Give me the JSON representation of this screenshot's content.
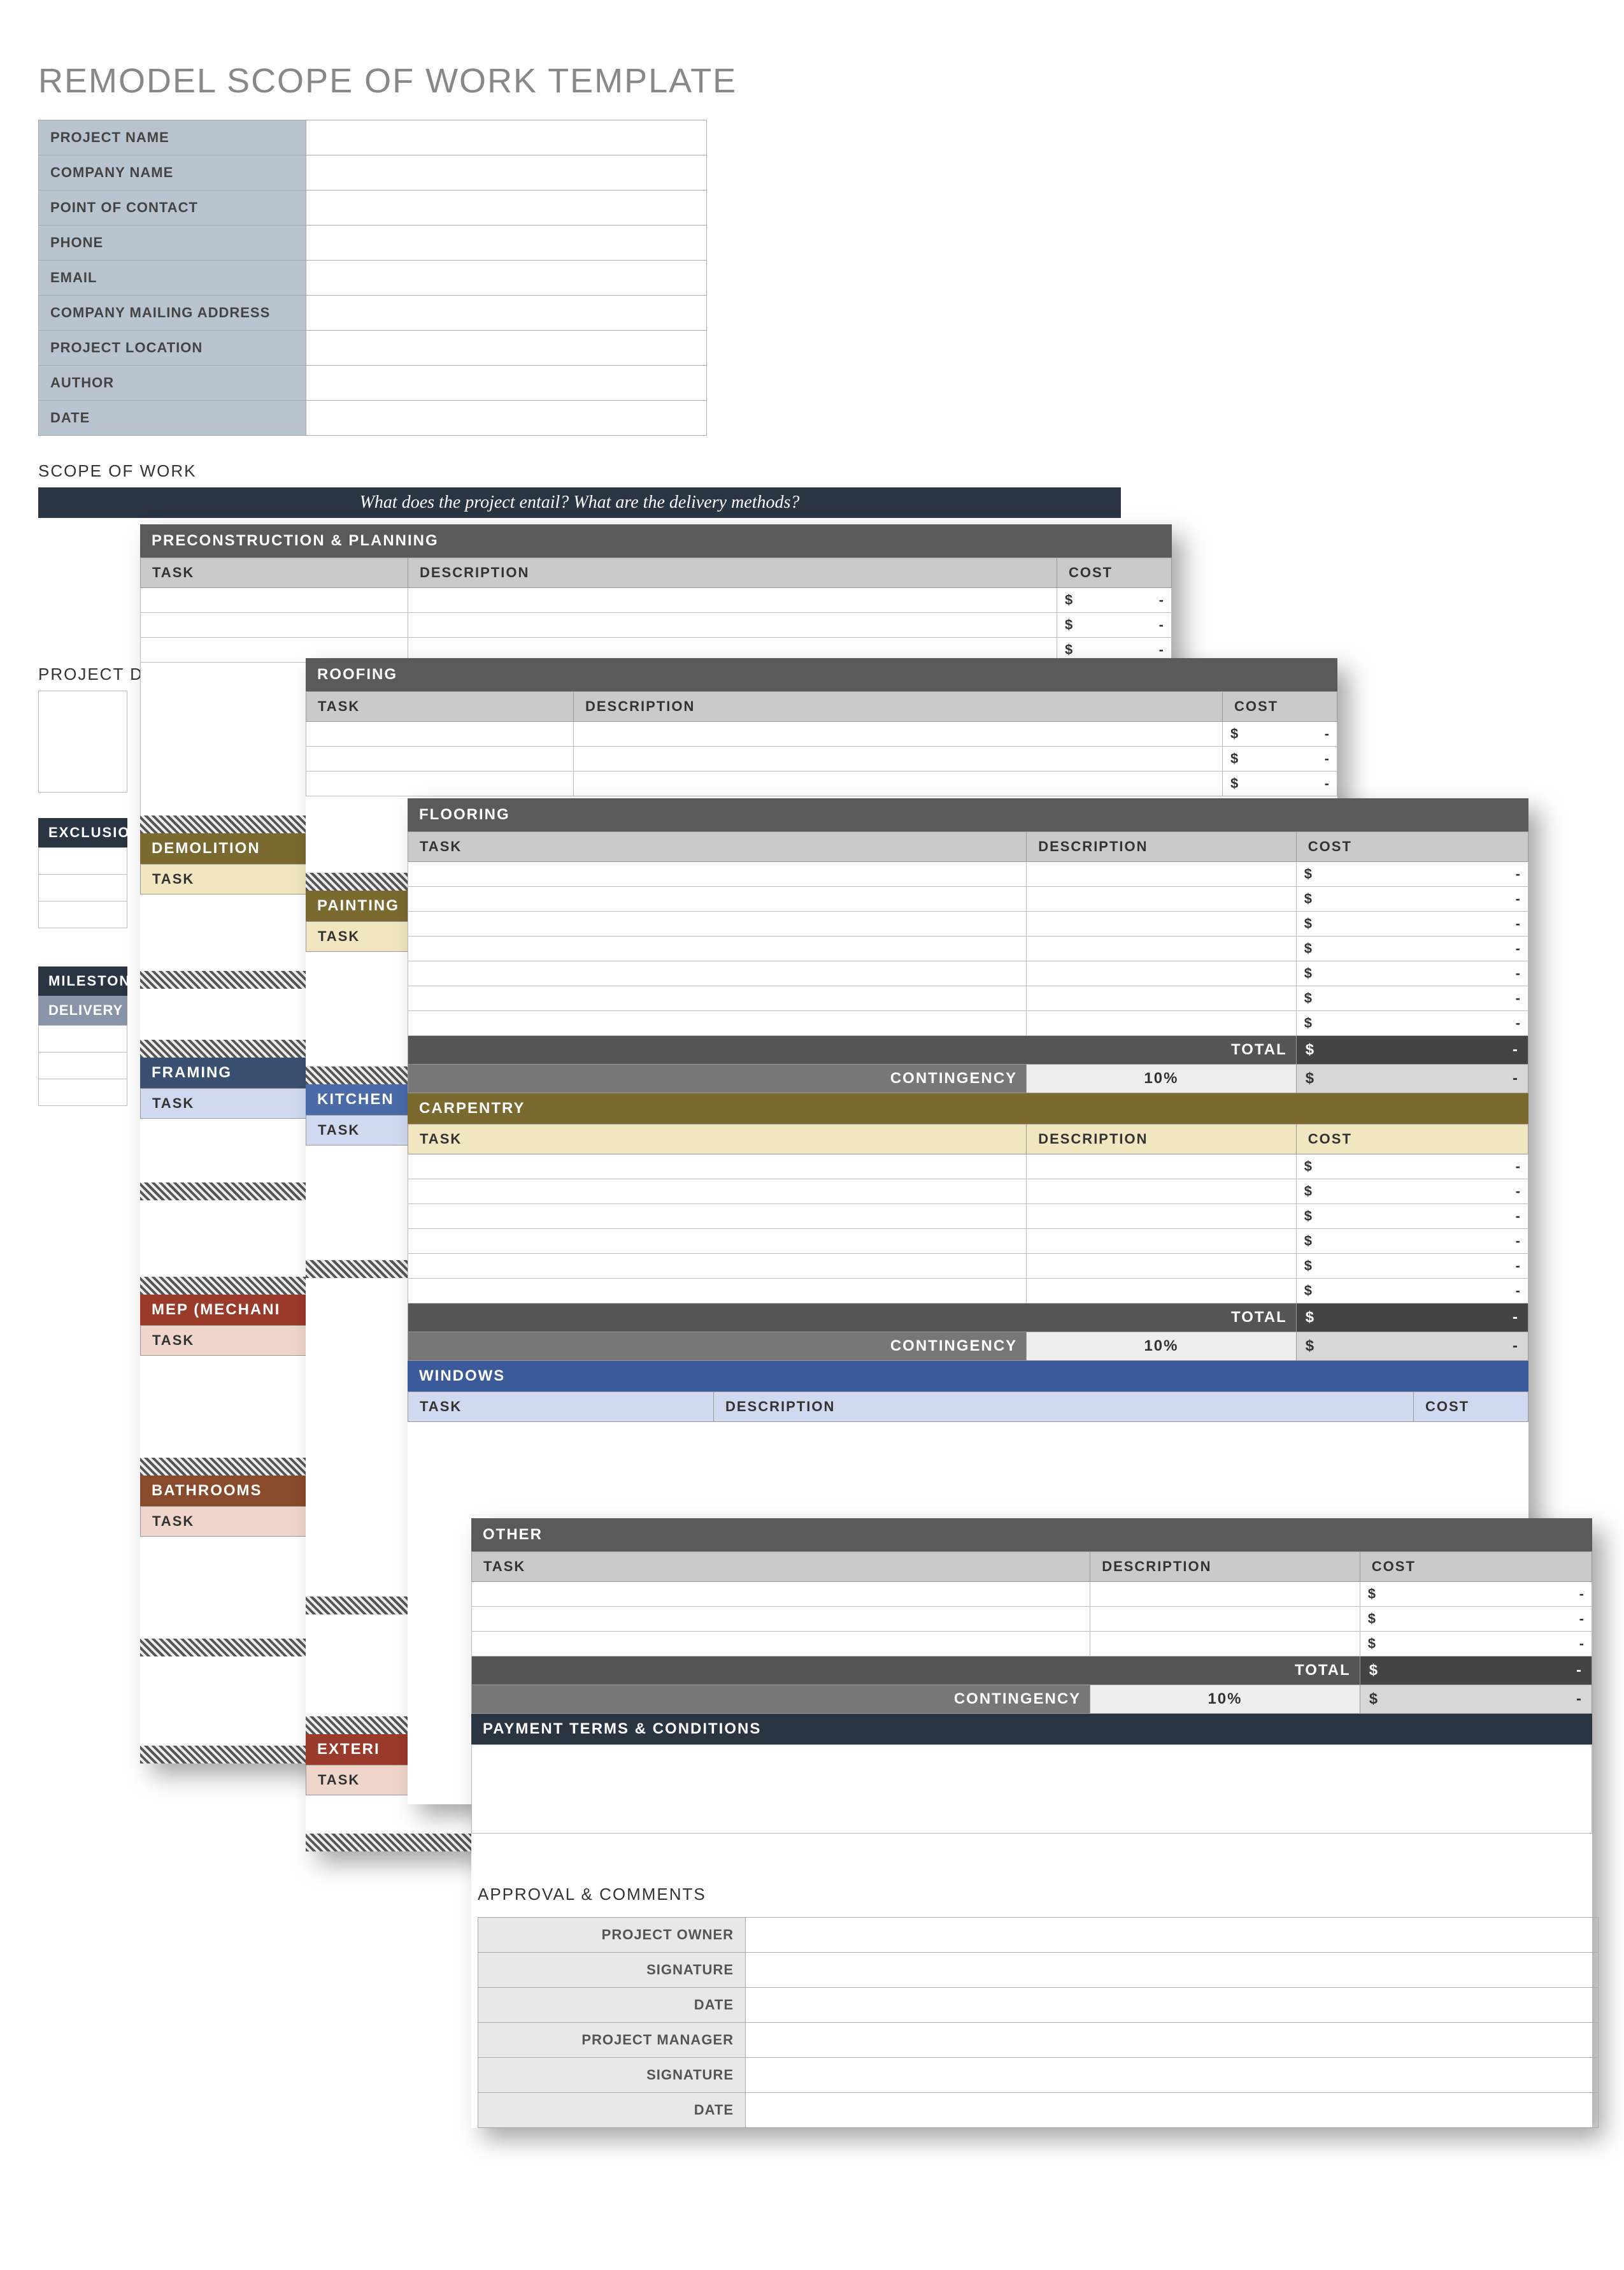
{
  "title": "REMODEL SCOPE OF WORK TEMPLATE",
  "info_labels": [
    "PROJECT NAME",
    "COMPANY NAME",
    "POINT OF CONTACT",
    "PHONE",
    "EMAIL",
    "COMPANY MAILING ADDRESS",
    "PROJECT LOCATION",
    "AUTHOR",
    "DATE"
  ],
  "sow_heading": "SCOPE OF WORK",
  "sow_question": "What does the project entail?  What are the delivery methods?",
  "proj_del_heading": "PROJECT DEL",
  "exclusions_heading": "EXCLUSION",
  "milestones_heading": "MILESTONES",
  "delivery_heading": "DELIVERY",
  "approval_heading": "APPROVAL & COMMENTS",
  "approval_labels": [
    "PROJECT OWNER",
    "SIGNATURE",
    "DATE",
    "PROJECT MANAGER",
    "SIGNATURE",
    "DATE"
  ],
  "columns": {
    "task": "TASK",
    "description": "DESCRIPTION",
    "cost": "COST"
  },
  "currency": "$",
  "dash": "-",
  "total_label": "TOTAL",
  "contingency_label": "CONTINGENCY",
  "contingency_pct": "10%",
  "payment_terms_label": "PAYMENT TERMS & CONDITIONS",
  "categories": {
    "precon": "PRECONSTRUCTION & PLANNING",
    "demo": "DEMOLITION",
    "roofing": "ROOFING",
    "painting": "PAINTING",
    "framing": "FRAMING",
    "flooring": "FLOORING",
    "kitchen": "KITCHEN",
    "carpentry": "CARPENTRY",
    "mep": "MEP (MECHANI",
    "bath": "BATHROOMS",
    "windows": "WINDOWS",
    "exterior": "EXTERI",
    "other": "OTHER"
  }
}
